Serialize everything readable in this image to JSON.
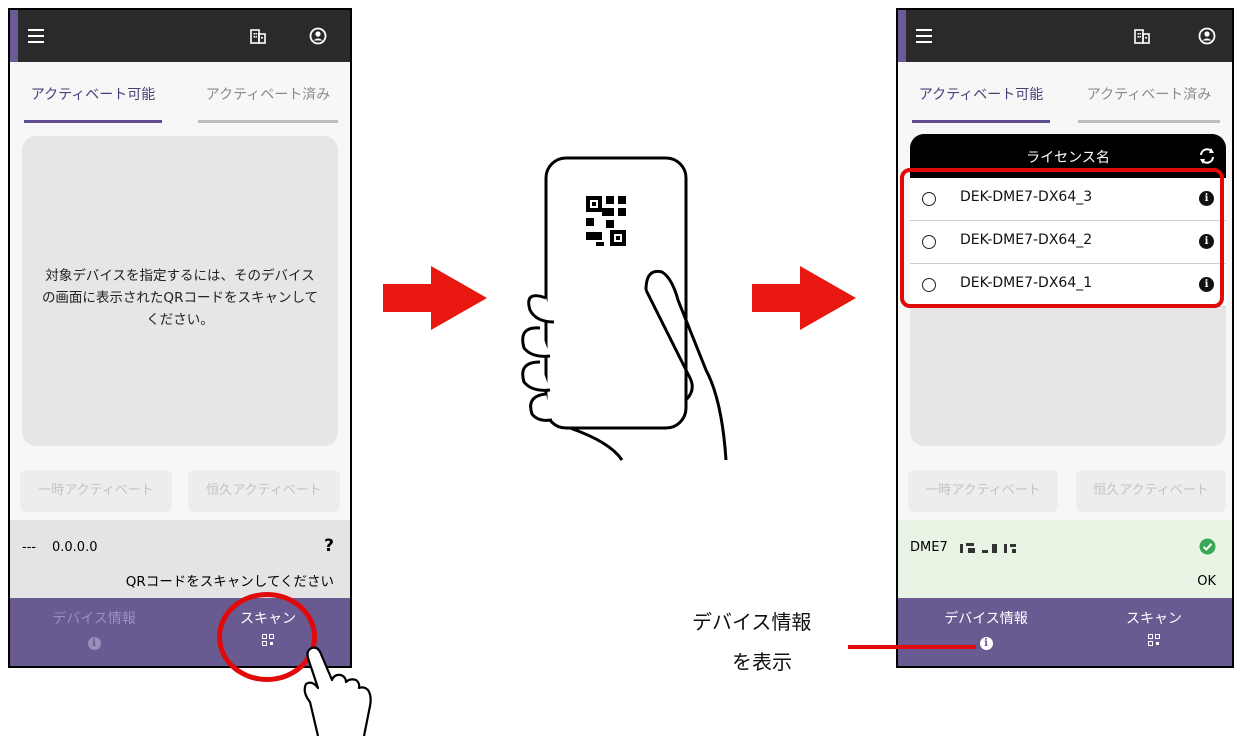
{
  "colors": {
    "appbar": "#2a2a2a",
    "accent_purple": "#6a5a92",
    "arrow_red": "#e8170f",
    "highlight_red": "#e10a0a",
    "status_green_bg": "#e8f4e4",
    "ok_green": "#3aa757"
  },
  "left_phone": {
    "tabs": {
      "available": "アクティベート可能",
      "activated": "アクティベート済み"
    },
    "message_line1": "対象デバイスを指定するには、そのデバイス",
    "message_line2": "の画面に表示されたQRコードをスキャンして",
    "message_line3": "ください。",
    "buttons": {
      "temporary": "一時アクティベート",
      "permanent": "恒久アクティベート"
    },
    "status": {
      "dash": "---",
      "version": "0.0.0.0",
      "help": "?",
      "hint": "QRコードをスキャンしてください"
    },
    "nav": {
      "device_info": "デバイス情報",
      "scan": "スキャン"
    }
  },
  "right_phone": {
    "tabs": {
      "available": "アクティベート可能",
      "activated": "アクティベート済み"
    },
    "table_header": "ライセンス名",
    "licenses": [
      "DEK-DME7-DX64_3",
      "DEK-DME7-DX64_2",
      "DEK-DME7-DX64_1"
    ],
    "buttons": {
      "temporary": "一時アクティベート",
      "permanent": "恒久アクティベート"
    },
    "status": {
      "device": "DME7",
      "ok": "OK"
    },
    "nav": {
      "device_info": "デバイス情報",
      "scan": "スキャン"
    }
  },
  "callout": {
    "line1": "デバイス情報",
    "line2": "を表示"
  },
  "icons": [
    "menu-icon",
    "building-icon",
    "account-icon",
    "info-icon",
    "qr-scan-icon",
    "refresh-icon",
    "check-circle-icon",
    "tap-hand-icon",
    "phone-hand-icon",
    "qr-code-icon",
    "arrow-right-icon"
  ]
}
